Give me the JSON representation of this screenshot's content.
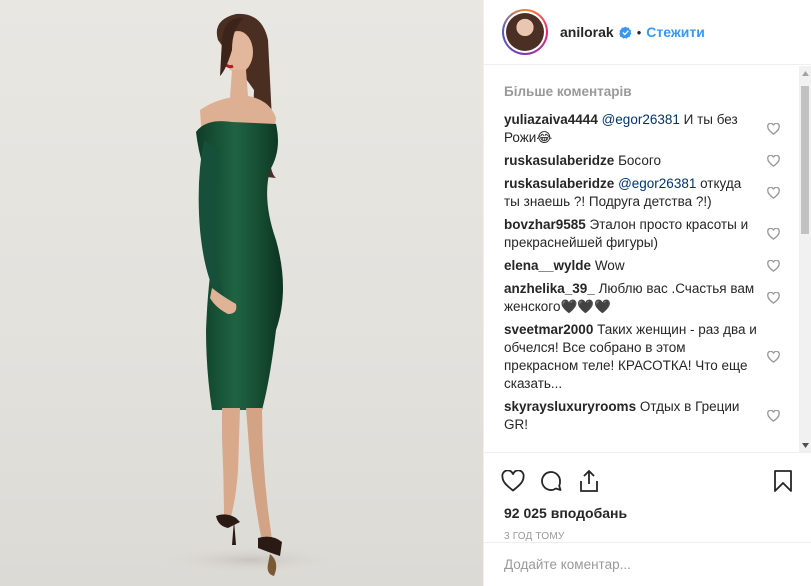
{
  "post": {
    "username": "anilorak",
    "follow_label": "Стежити",
    "separator": "•"
  },
  "comments_section": {
    "more_label": "Більше коментарів",
    "items": [
      {
        "user": "yuliazaiva4444",
        "mention": "@egor26381",
        "text": " И ты без Рожи😂"
      },
      {
        "user": "ruskasulaberidze",
        "mention": "",
        "text": " Босого"
      },
      {
        "user": "ruskasulaberidze",
        "mention": "@egor26381",
        "text": " откуда ты знаешь ?! Подруга детства ?!)"
      },
      {
        "user": "bovzhar9585",
        "mention": "",
        "text": " Эталон просто красоты и прекраснейшей фигуры)"
      },
      {
        "user": "elena__wylde",
        "mention": "",
        "text": " Wow"
      },
      {
        "user": "anzhelika_39_",
        "mention": "",
        "text": " Люблю вас .Счастья вам женского🖤🖤🖤"
      },
      {
        "user": "sveetmar2000",
        "mention": "",
        "text": " Таких женщин - раз два и обчелся! Все собрано в этом прекрасном теле! КРАСОТКА! Что еще сказать..."
      },
      {
        "user": "skyraysluxuryrooms",
        "mention": "",
        "text": " Отдых в Греции GR!"
      }
    ]
  },
  "engagement": {
    "likes": "92 025 вподобань",
    "time": "3 год тому"
  },
  "add_comment": {
    "placeholder": "Додайте коментар..."
  },
  "icons": {
    "like": "heart-icon",
    "comment": "comment-icon",
    "share": "share-icon",
    "save": "bookmark-icon",
    "verified": "verified-badge-icon"
  },
  "colors": {
    "accent": "#3897f0",
    "mention": "#003569",
    "muted": "#999999",
    "dress": "#1e5b3c"
  }
}
